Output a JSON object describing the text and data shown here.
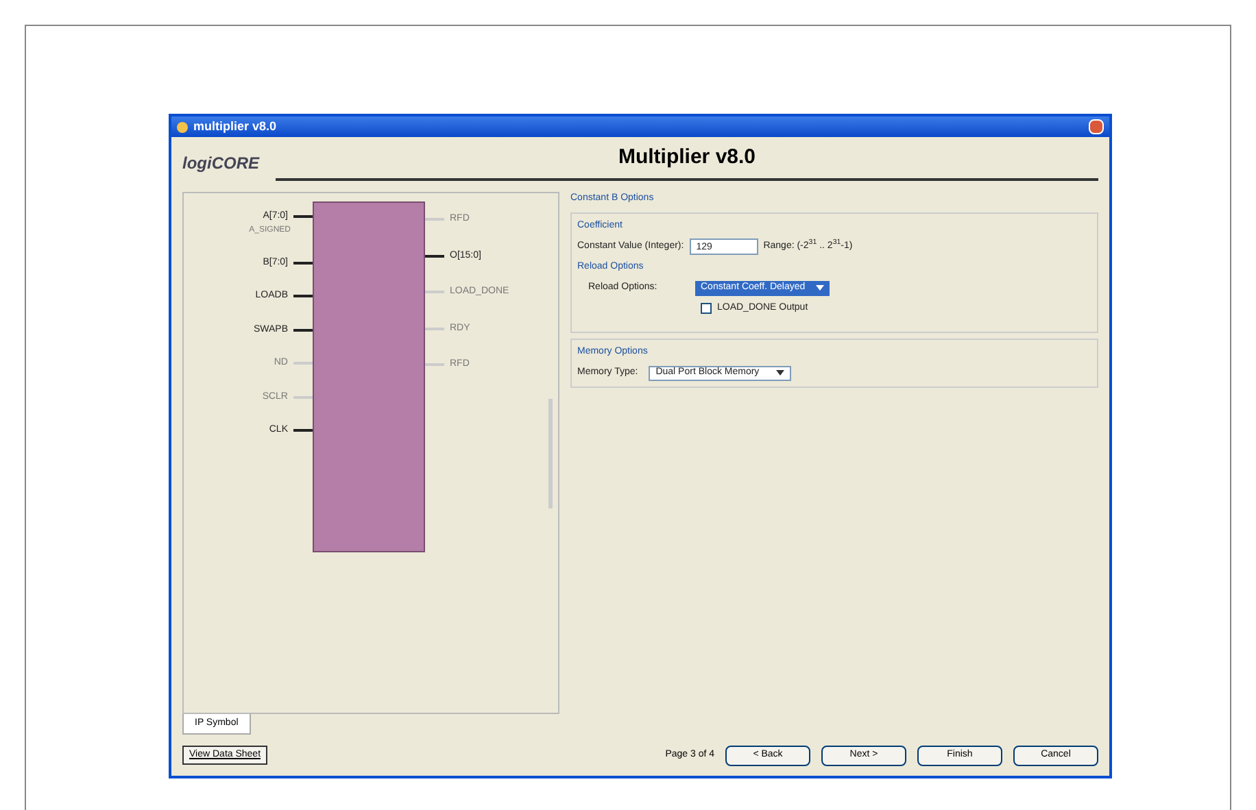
{
  "window": {
    "title": "multiplier v8.0"
  },
  "header": {
    "logo": "logiCORE",
    "title": "Multiplier v8.0"
  },
  "symbol": {
    "left_pins": [
      {
        "label": "A[7:0]",
        "active": true,
        "sub": "A_SIGNED"
      },
      {
        "label": "B[7:0]",
        "active": true
      },
      {
        "label": "LOADB",
        "active": true
      },
      {
        "label": "SWAPB",
        "active": true
      },
      {
        "label": "ND",
        "active": false
      },
      {
        "label": "SCLR",
        "active": false
      },
      {
        "label": "CLK",
        "active": true
      }
    ],
    "right_pins": [
      {
        "label": "RFD",
        "active": false
      },
      {
        "label": "O[15:0]",
        "active": true
      },
      {
        "label": "LOAD_DONE",
        "active": false
      },
      {
        "label": "RDY",
        "active": false
      },
      {
        "label": "RFD",
        "active": false
      }
    ]
  },
  "tabs": [
    {
      "label": "IP Symbol",
      "selected": true
    }
  ],
  "options": {
    "section": "Constant B Options",
    "group": "Coefficient",
    "constant_label": "Constant Value (Integer):",
    "constant_value": "129",
    "range": "Range: (-2$^{31}$ .. 2$^{31}$-1)",
    "reload_group": "Reload Options",
    "reload_label": "Reload Options:",
    "reload_value": "Constant Coeff. Delayed",
    "load_done": {
      "label": "LOAD_DONE Output",
      "checked": false
    },
    "memory_group": "Memory Options",
    "memory_label": "Memory Type:",
    "memory_value": "Dual Port Block Memory"
  },
  "footer": {
    "datasheet": "View Data Sheet",
    "page": "Page 3 of 4",
    "buttons": [
      "< Back",
      "Next >",
      "Finish",
      "Cancel"
    ]
  }
}
